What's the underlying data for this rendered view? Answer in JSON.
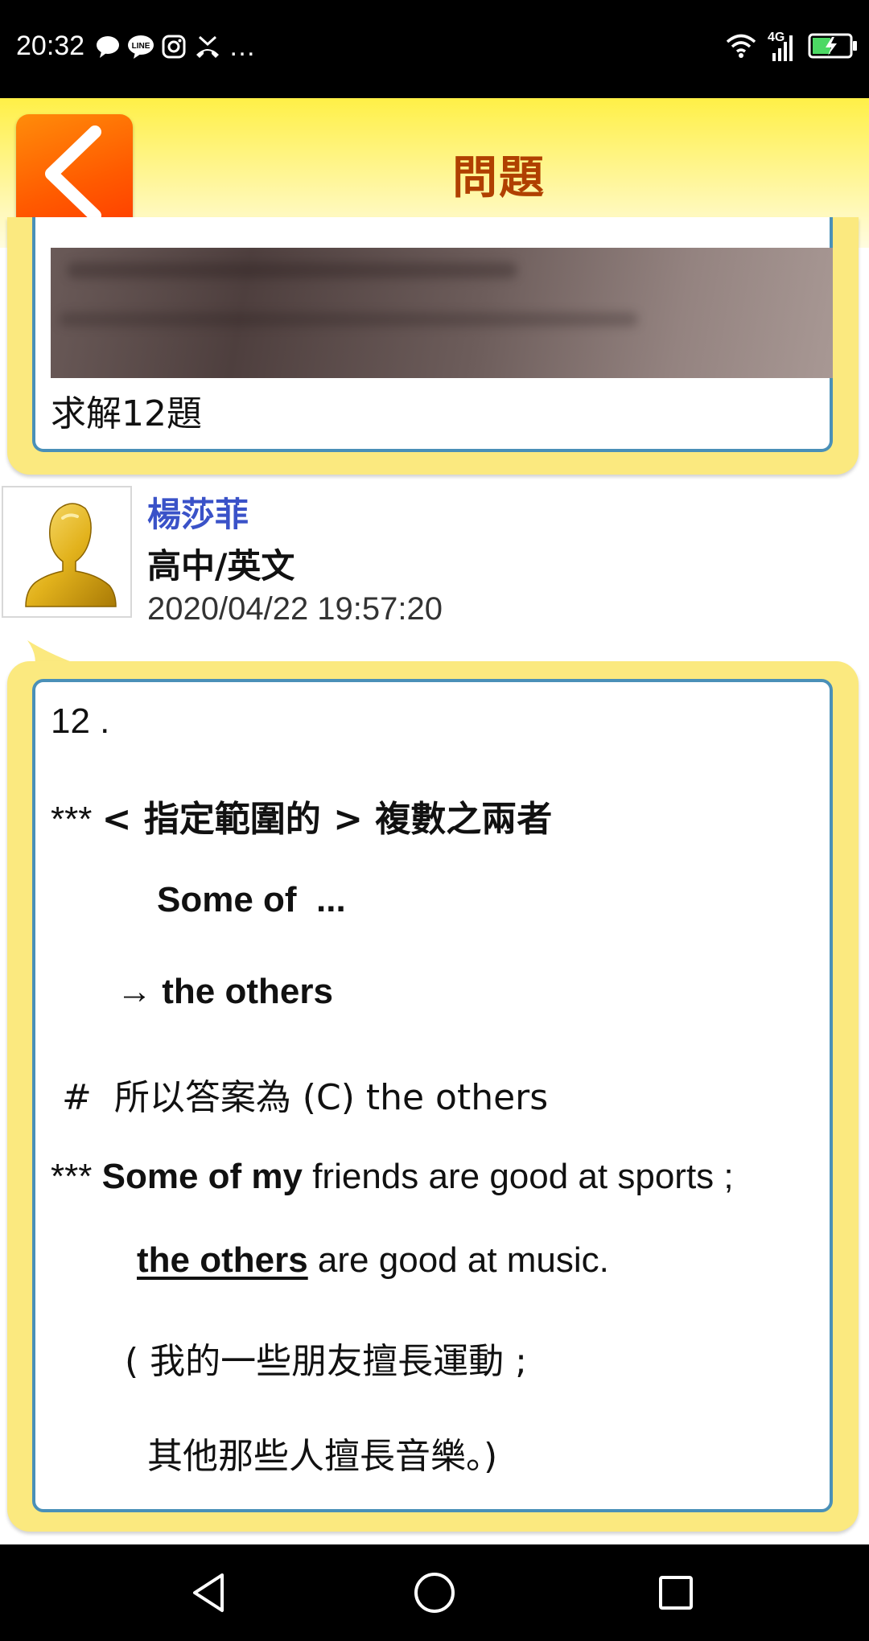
{
  "status_bar": {
    "time": "20:32",
    "more": "…",
    "network": "4G",
    "icons": [
      "chat-bubble-icon",
      "line-app-icon",
      "instagram-icon",
      "missed-call-icon",
      "wifi-icon",
      "signal-icon",
      "battery-charging-icon"
    ]
  },
  "header": {
    "title": "問題",
    "back_icon": "chevron-left-icon",
    "colors": {
      "title": "#b04000",
      "back_button": "#ff5a00",
      "header_bg": "#fff047"
    }
  },
  "question": {
    "text": "求解12題"
  },
  "answer": {
    "author": "楊莎菲",
    "subject": "高中/英文",
    "timestamp": "2020/04/22 19:57:20",
    "lines": {
      "l1": "12 .",
      "l2_prefix": "*** ",
      "l2_bold": "< 指定範圍的 > 複數之兩者",
      "l3": "Some of  ...",
      "l4": "→ the others",
      "l5": " #  所以答案為 (C) the others",
      "l6_prefix": "*** ",
      "l6_bold": "Some of my",
      "l6_rest": " friends are good at sports ;",
      "l7_bold": "the others",
      "l7_rest": " are good at music.",
      "l8": "( 我的一些朋友擅長運動 ;",
      "l9": "其他那些人擅長音樂。)"
    }
  },
  "nav_bar": {
    "back": "nav-back-icon",
    "home": "nav-home-icon",
    "recents": "nav-recents-icon"
  }
}
